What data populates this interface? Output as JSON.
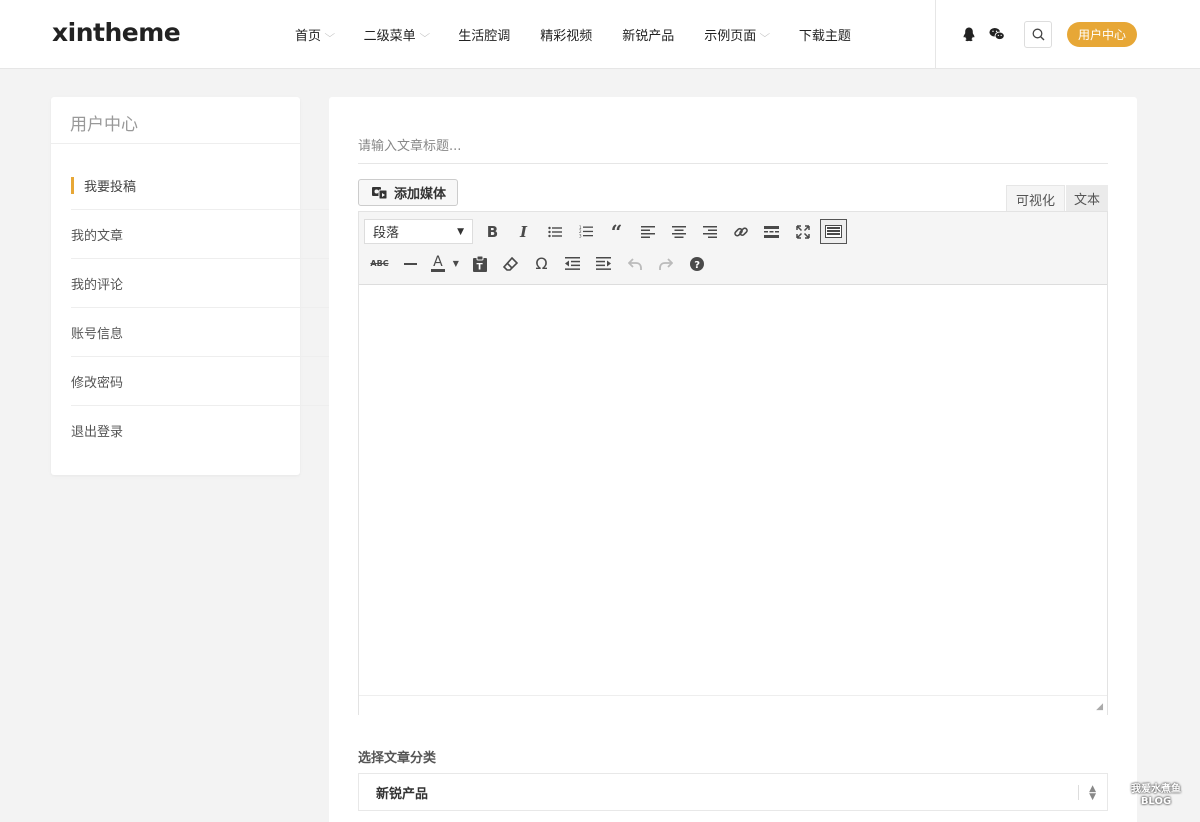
{
  "header": {
    "logo": "xintheme",
    "nav": [
      {
        "label": "首页",
        "dropdown": true
      },
      {
        "label": "二级菜单",
        "dropdown": true
      },
      {
        "label": "生活腔调",
        "dropdown": false
      },
      {
        "label": "精彩视频",
        "dropdown": false
      },
      {
        "label": "新锐产品",
        "dropdown": false
      },
      {
        "label": "示例页面",
        "dropdown": true
      },
      {
        "label": "下载主题",
        "dropdown": false
      }
    ],
    "icons": [
      "qq-icon",
      "wechat-icon",
      "search-icon"
    ],
    "user_center_button": "用户中心",
    "accent_color": "#e7a736"
  },
  "sidebar": {
    "title": "用户中心",
    "items": [
      {
        "label": "我要投稿",
        "active": true
      },
      {
        "label": "我的文章",
        "active": false
      },
      {
        "label": "我的评论",
        "active": false
      },
      {
        "label": "账号信息",
        "active": false
      },
      {
        "label": "修改密码",
        "active": false
      },
      {
        "label": "退出登录",
        "active": false
      }
    ]
  },
  "main": {
    "title_placeholder": "请输入文章标题...",
    "add_media_label": "添加媒体",
    "tabs": {
      "visual": "可视化",
      "text": "文本"
    },
    "format_select": "段落",
    "toolbar_icons": [
      "bold-icon",
      "italic-icon",
      "bullet-list-icon",
      "numbered-list-icon",
      "blockquote-icon",
      "align-left-icon",
      "align-center-icon",
      "align-right-icon",
      "link-icon",
      "read-more-icon",
      "fullscreen-icon",
      "toolbar-toggle-icon",
      "strikethrough-icon",
      "horizontal-line-icon",
      "text-color-icon",
      "paste-text-icon",
      "clear-formatting-icon",
      "special-character-icon",
      "outdent-icon",
      "indent-icon",
      "undo-icon",
      "redo-icon",
      "help-icon"
    ],
    "category_label": "选择文章分类",
    "category_value": "新锐产品"
  },
  "watermark": {
    "line1": "我爱水煮鱼",
    "line2": "BLOG"
  }
}
